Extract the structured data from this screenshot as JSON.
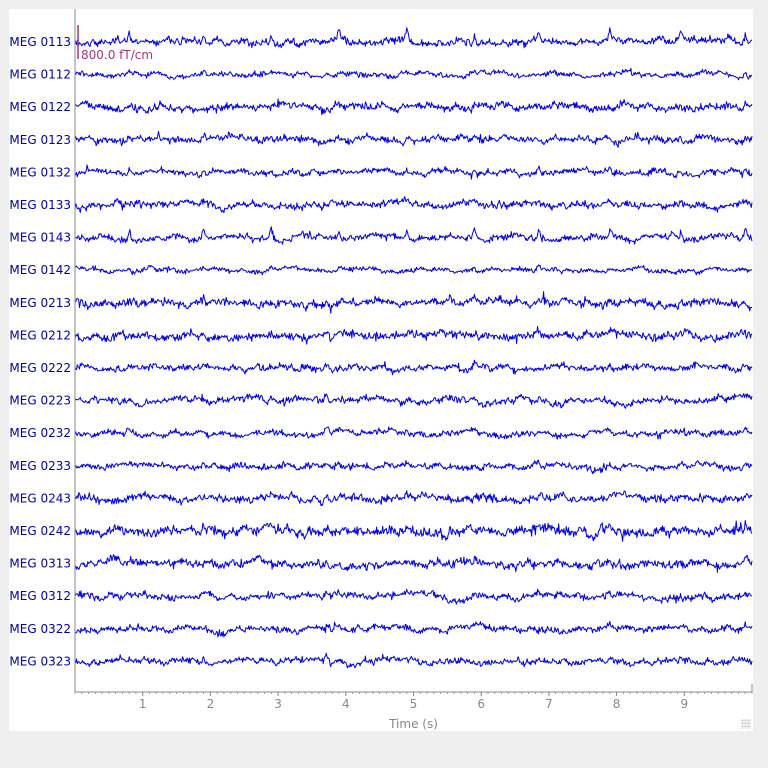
{
  "chart_data": {
    "type": "line",
    "xlabel": "Time (s)",
    "xlim": [
      0,
      10
    ],
    "x_ticks": [
      1,
      2,
      3,
      4,
      5,
      6,
      7,
      8,
      9
    ],
    "x_tick_labels": [
      "1",
      "2",
      "3",
      "4",
      "5",
      "6",
      "7",
      "8",
      "9"
    ],
    "grid": false,
    "scale_bar_label": "800.0 fT/cm",
    "channels": [
      "MEG 0113",
      "MEG 0112",
      "MEG 0122",
      "MEG 0123",
      "MEG 0132",
      "MEG 0133",
      "MEG 0143",
      "MEG 0142",
      "MEG 0213",
      "MEG 0212",
      "MEG 0222",
      "MEG 0223",
      "MEG 0232",
      "MEG 0233",
      "MEG 0243",
      "MEG 0242",
      "MEG 0313",
      "MEG 0312",
      "MEG 0322",
      "MEG 0323"
    ],
    "spike_times": [
      0.8,
      1.9,
      2.9,
      3.9,
      4.9,
      5.9,
      6.85,
      7.9,
      8.95,
      9.9
    ]
  },
  "colors": {
    "trace": "#0000ee",
    "label": "#0000aa",
    "scale": "#aa3377",
    "axis": "#888888",
    "background": "#ffffff"
  }
}
